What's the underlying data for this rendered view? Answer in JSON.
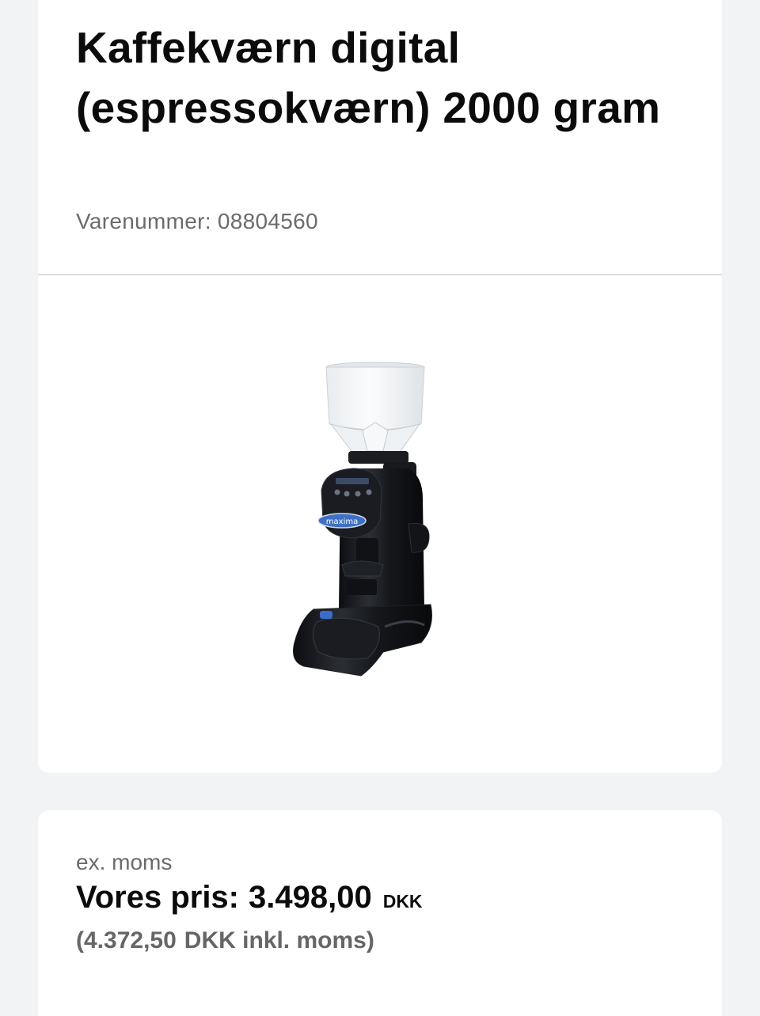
{
  "product": {
    "title": "Kaffekværn digital (espressokværn) 2000 gram",
    "sku_label": "Varenummer:",
    "sku_value": "08804560",
    "image_alt": "Kaffekværn digital (espressokværn) 2000 gram",
    "brand_on_image": "maxima"
  },
  "price": {
    "vat_label": "ex. moms",
    "our_price_label": "Vores pris:",
    "amount": "3.498,00",
    "currency": "DKK",
    "incl_open": "(4.372,50",
    "incl_text": "DKK inkl. moms)"
  },
  "colors": {
    "page_background": "#f2f3f5",
    "card_background": "#ffffff",
    "title": "#0b0b0b",
    "muted_text": "#6b6b6b",
    "brand_badge": "#3f6fc4"
  }
}
